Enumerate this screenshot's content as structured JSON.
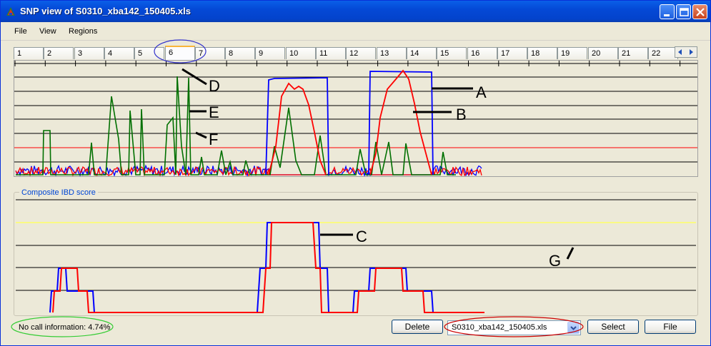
{
  "window": {
    "title": "SNP view of S0310_xba142_150405.xls",
    "controls": {
      "minimize": "minimize-icon",
      "maximize": "maximize-icon",
      "close": "close-icon"
    }
  },
  "menu": {
    "items": [
      "File",
      "View",
      "Regions"
    ]
  },
  "tabs": {
    "items": [
      "1",
      "2",
      "3",
      "4",
      "5",
      "6",
      "7",
      "8",
      "9",
      "10",
      "11",
      "12",
      "13",
      "14",
      "15",
      "16",
      "17",
      "18",
      "19",
      "20",
      "21",
      "22"
    ],
    "active_index": 5
  },
  "composite": {
    "label": "Composite IBD score"
  },
  "status": {
    "no_call_text": "No call information: 4.74%"
  },
  "buttons": {
    "delete": "Delete",
    "select": "Select",
    "file": "File"
  },
  "file_select": {
    "value": "S0310_xba142_150405.xls"
  },
  "annotations": {
    "a": "A",
    "b": "B",
    "c": "C",
    "d": "D",
    "e": "E",
    "f": "F",
    "g": "G"
  },
  "colors": {
    "blue_trace": "#0000ff",
    "red_trace": "#ff0000",
    "green_trace": "#007000",
    "threshold_line": "#ff0000",
    "composite_threshold": "#ffff66",
    "annotation_ellipse_blue": "#3333cc",
    "annotation_ellipse_red": "#cc0000",
    "annotation_ellipse_green": "#33cc33"
  }
}
